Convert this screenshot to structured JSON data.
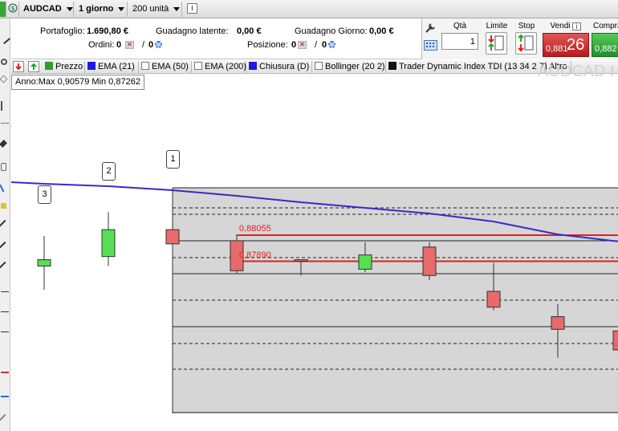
{
  "toolbar": {
    "symbol": "AUDCAD",
    "timeframe": "1 giorno",
    "units": "200 unità",
    "info_icon": "info-icon"
  },
  "account": {
    "portfolio_label": "Portafoglio:",
    "portfolio_value": "1.690,80 €",
    "orders_label": "Ordini:",
    "orders_value": "0",
    "orders_value2": "0",
    "latent_gain_label": "Guadagno latente:",
    "latent_gain_value": "0,00 €",
    "position_label": "Posizione:",
    "position_value": "0",
    "position_value2": "0",
    "day_gain_label": "Guadagno Giorno:",
    "day_gain_value": "0,00 €"
  },
  "order_panel": {
    "qty_label": "Qtà",
    "qty_value": "1",
    "limit_label": "Limite",
    "stop_label": "Stop",
    "sell_label": "Vendi",
    "buy_label": "Compra",
    "sell_price_small": "0,881",
    "sell_price_big": "26",
    "buy_price_small": "0,882"
  },
  "indicators": [
    {
      "label": "Prezzo",
      "color": "#2e9e2e",
      "type": "swatch"
    },
    {
      "label": "EMA (21)",
      "color": "#1a1ae6",
      "type": "swatch"
    },
    {
      "label": "EMA (50)",
      "color": "",
      "type": "check"
    },
    {
      "label": "EMA (200)",
      "color": "",
      "type": "check"
    },
    {
      "label": "Chiusura (D)",
      "color": "#1a1ae6",
      "type": "swatch"
    },
    {
      "label": "Bollinger (20 2)",
      "color": "",
      "type": "check"
    },
    {
      "label": "Trader Dynamic Index TDI (13 34 2 7)",
      "color": "#111111",
      "type": "swatch"
    },
    {
      "label": "Altro",
      "color": "",
      "type": "none"
    }
  ],
  "range": {
    "text": "Anno:Max 0,90579 Min 0,87262"
  },
  "watermark": "AUDCAD I",
  "chart_data": {
    "type": "candlestick",
    "candles": [
      {
        "o": 0.8786,
        "h": 0.8805,
        "l": 0.8771,
        "c": 0.879,
        "dir": "up"
      },
      {
        "o": 0.8792,
        "h": 0.882,
        "l": 0.8786,
        "c": 0.8809,
        "dir": "up"
      },
      {
        "o": 0.8809,
        "h": 0.8809,
        "l": 0.8799,
        "c": 0.88,
        "dir": "down"
      },
      {
        "o": 0.8802,
        "h": 0.8806,
        "l": 0.8781,
        "c": 0.8783,
        "dir": "down"
      },
      {
        "o": 0.879,
        "h": 0.879,
        "l": 0.878,
        "c": 0.8789,
        "dir": "down"
      },
      {
        "o": 0.8784,
        "h": 0.8801,
        "l": 0.8782,
        "c": 0.8793,
        "dir": "up"
      },
      {
        "o": 0.8798,
        "h": 0.8801,
        "l": 0.8777,
        "c": 0.878,
        "dir": "down"
      },
      {
        "o": 0.877,
        "h": 0.8788,
        "l": 0.8758,
        "c": 0.876,
        "dir": "down"
      },
      {
        "o": 0.8754,
        "h": 0.8762,
        "l": 0.8728,
        "c": 0.8746,
        "dir": "down"
      },
      {
        "o": 0.8745,
        "h": 0.8745,
        "l": 0.8733,
        "c": 0.8733,
        "dir": "down"
      }
    ],
    "ema": [
      0.885,
      0.884,
      0.8828,
      0.8816,
      0.8805,
      0.8796,
      0.8789,
      0.8781,
      0.8767,
      0.8748
    ],
    "price_levels": [
      {
        "value": 0.88055,
        "label": "0,88055"
      },
      {
        "value": 0.8789,
        "label": "0,87890"
      }
    ],
    "callouts": [
      "3",
      "2",
      "1"
    ],
    "colors": {
      "up": "#55e055",
      "down": "#e86a6a",
      "ema": "#3a2ac8",
      "level": "#e0201f",
      "band": "#d6d6d6"
    }
  }
}
